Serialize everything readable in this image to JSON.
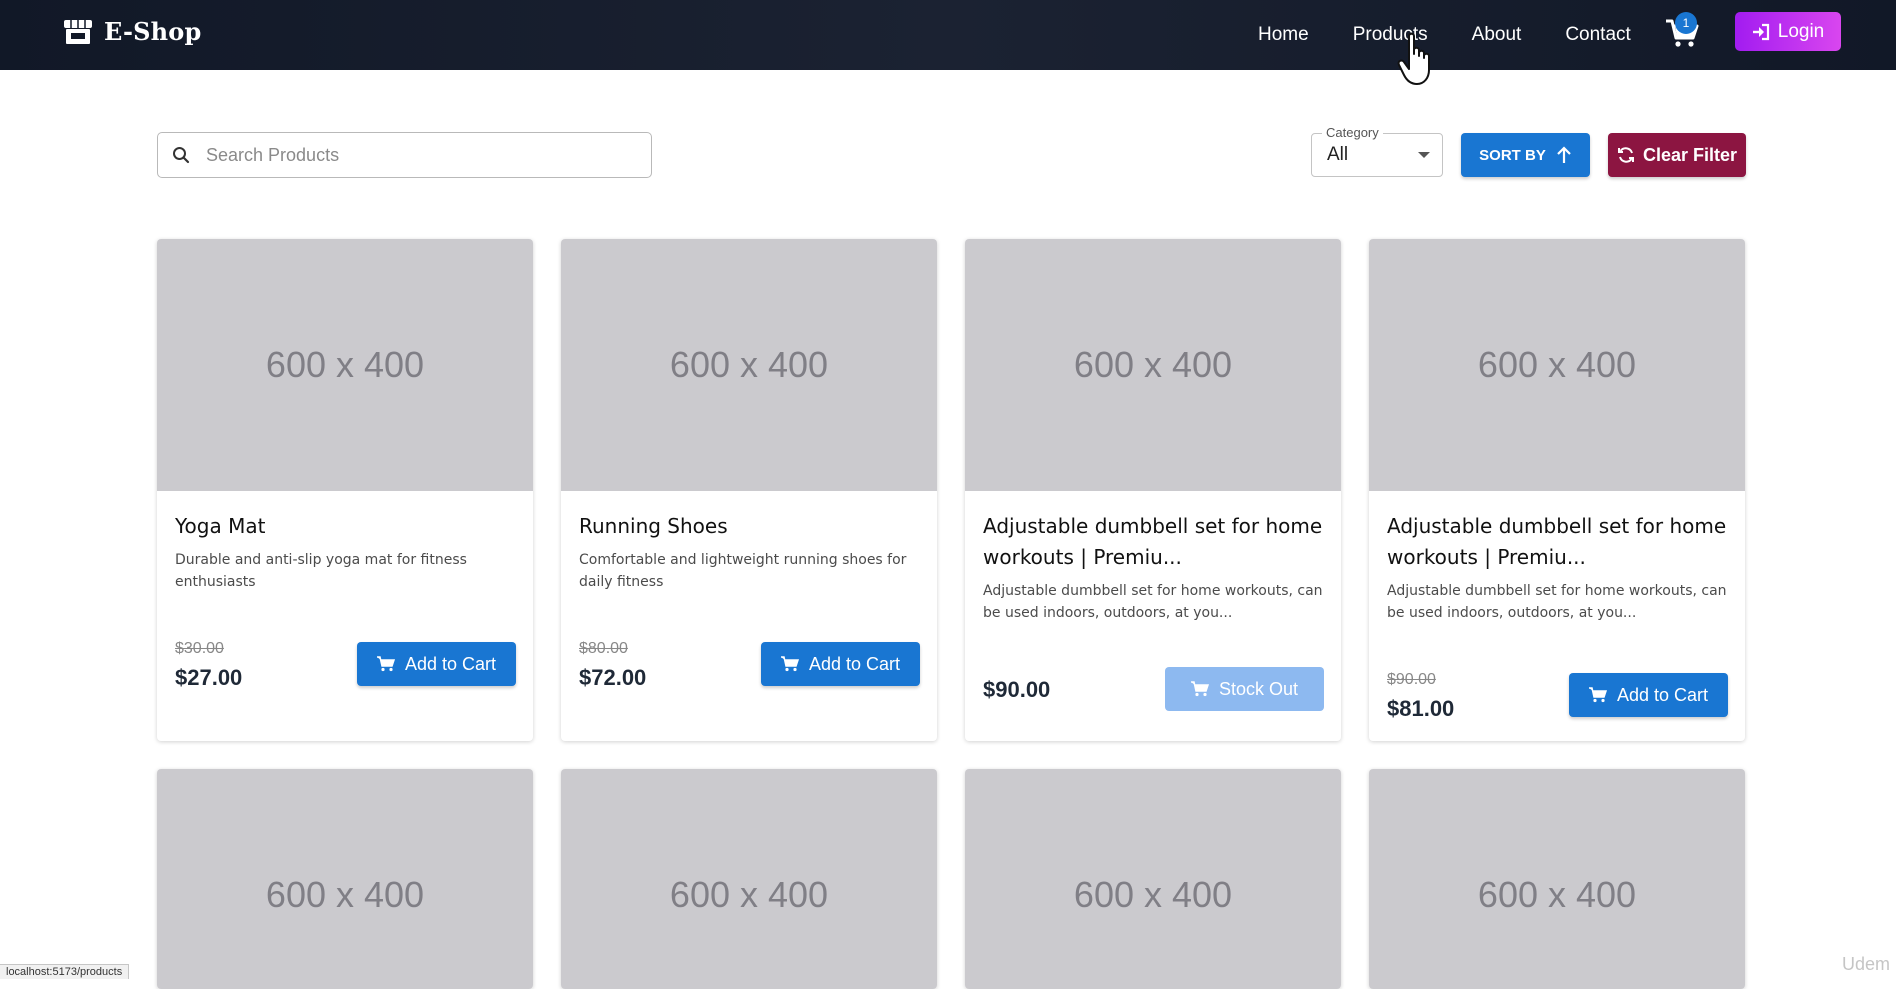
{
  "brand": {
    "name": "E-Shop"
  },
  "nav": {
    "links": [
      "Home",
      "Products",
      "About",
      "Contact"
    ],
    "cart_count": "1",
    "login_label": "Login"
  },
  "filters": {
    "search_placeholder": "Search Products",
    "category_label": "Category",
    "category_value": "All",
    "sort_label": "SORT BY",
    "clear_label": "Clear Filter"
  },
  "products": [
    {
      "image": "600 x 400",
      "title": "Yoga Mat",
      "description": "Durable and anti-slip yoga mat for fitness enthusiasts",
      "old_price": "$30.00",
      "price": "$27.00",
      "button": "Add to Cart",
      "in_stock": true
    },
    {
      "image": "600 x 400",
      "title": "Running Shoes",
      "description": "Comfortable and lightweight running shoes for daily fitness",
      "old_price": "$80.00",
      "price": "$72.00",
      "button": "Add to Cart",
      "in_stock": true
    },
    {
      "image": "600 x 400",
      "title": "Adjustable dumbbell set for home workouts | Premiu...",
      "description": "Adjustable dumbbell set for home workouts, can be used indoors, outdoors, at you...",
      "old_price": "",
      "price": "$90.00",
      "button": "Stock Out",
      "in_stock": false
    },
    {
      "image": "600 x 400",
      "title": "Adjustable dumbbell set for home workouts | Premiu...",
      "description": "Adjustable dumbbell set for home workouts, can be used indoors, outdoors, at you...",
      "old_price": "$90.00",
      "price": "$81.00",
      "button": "Add to Cart",
      "in_stock": true
    },
    {
      "image": "600 x 400"
    },
    {
      "image": "600 x 400"
    },
    {
      "image": "600 x 400"
    },
    {
      "image": "600 x 400"
    }
  ],
  "status_bar": {
    "url": "localhost:5173/products"
  },
  "watermark": "Udem",
  "colors": {
    "navbar": "#111827",
    "primary": "#1976d2",
    "login_gradient_start": "#a21cf0",
    "login_gradient_end": "#d946ef",
    "clear_filter": "#8c1541",
    "disabled": "#8db9f0"
  }
}
